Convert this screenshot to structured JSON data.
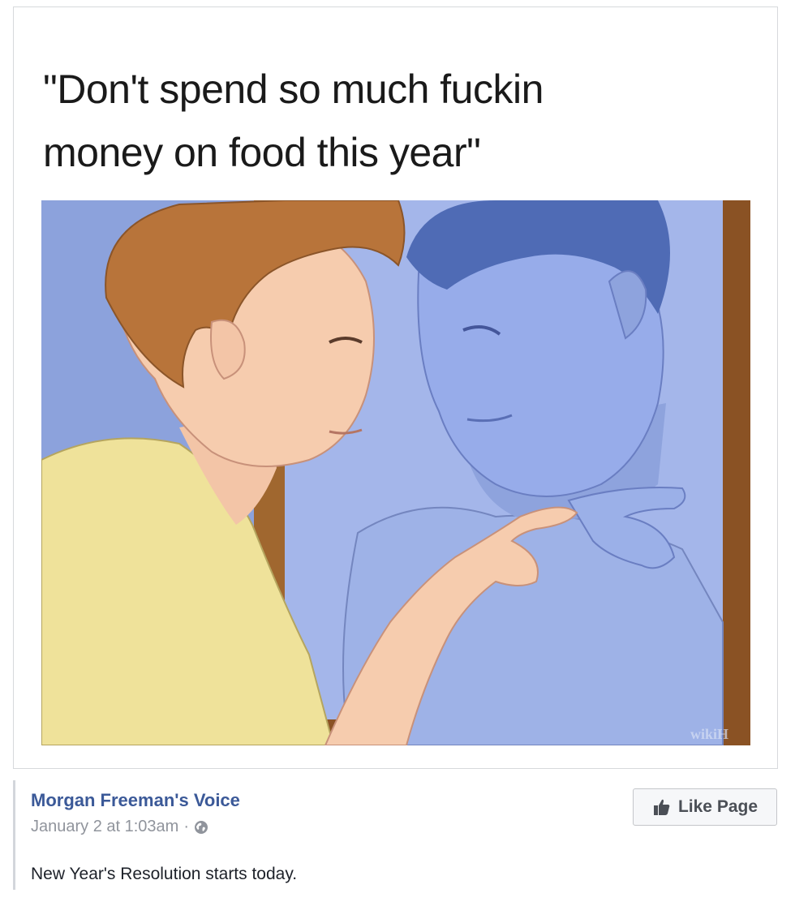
{
  "meme": {
    "caption_line1": "\"Don't spend so much fuckin",
    "caption_line2": "money on food this year\"",
    "watermark": "wikiH"
  },
  "post": {
    "page_name": "Morgan Freeman's Voice",
    "date": "January 2 at 1:03am",
    "separator": "·",
    "privacy_icon": "globe-icon",
    "text": "New Year's Resolution starts today."
  },
  "actions": {
    "like_page_label": "Like Page",
    "like_icon": "thumbs-up-icon"
  },
  "colors": {
    "link_blue": "#3b5998",
    "meta_gray": "#90949c",
    "mirror_blue": "#8fa6dd",
    "shirt_yellow": "#efe29a",
    "hair_brown": "#b8743a"
  }
}
